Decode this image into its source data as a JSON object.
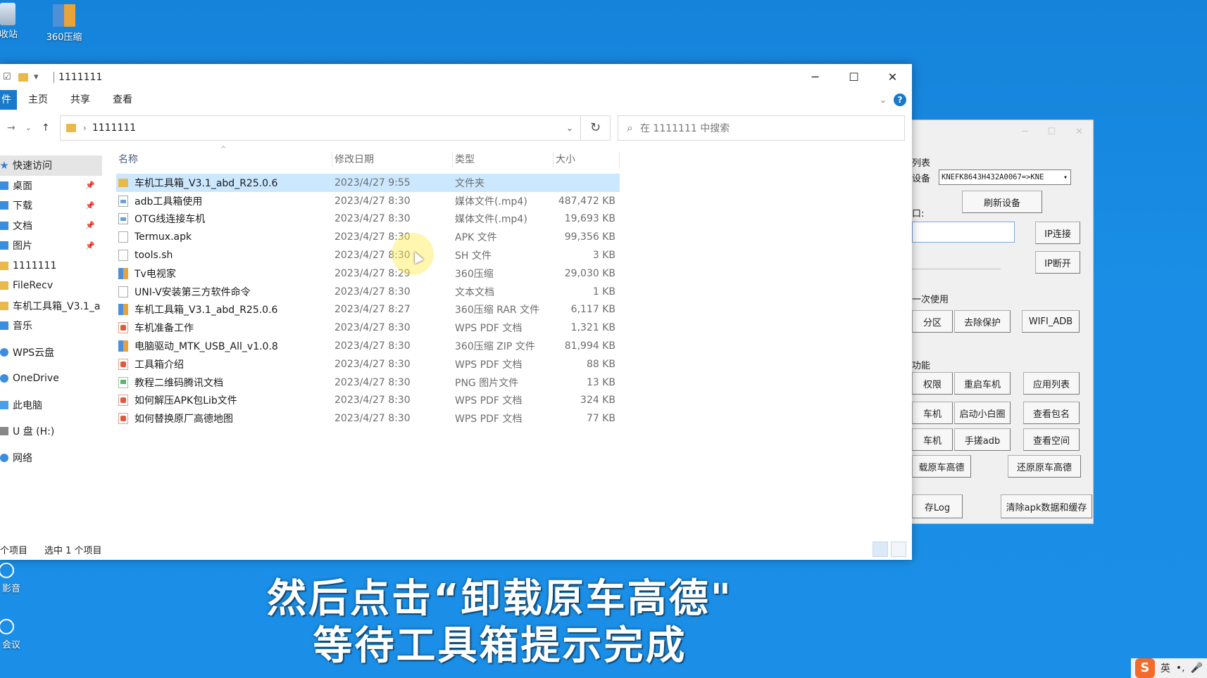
{
  "desktop": {
    "icons": [
      {
        "label": "收站"
      },
      {
        "label": "360压缩"
      },
      {
        "label": "影音"
      },
      {
        "label": "会议"
      }
    ]
  },
  "explorer": {
    "title": "1111111",
    "quick_access_chevron": "▾",
    "ribbon": {
      "file": "件",
      "tabs": [
        "主页",
        "共享",
        "查看"
      ],
      "help": "?"
    },
    "address": {
      "path": "1111111"
    },
    "search": {
      "placeholder": "在 1111111 中搜索"
    },
    "nav_pane": [
      {
        "label": "快速访问",
        "icon": "star-icon"
      },
      {
        "label": "桌面",
        "icon": "desktop-icon",
        "pinned": true
      },
      {
        "label": "下载",
        "icon": "download-icon",
        "pinned": true
      },
      {
        "label": "文档",
        "icon": "document-icon",
        "pinned": true
      },
      {
        "label": "图片",
        "icon": "pictures-icon",
        "pinned": true
      },
      {
        "label": "1111111",
        "icon": "folder-icon"
      },
      {
        "label": "FileRecv",
        "icon": "folder-icon"
      },
      {
        "label": "车机工具箱_V3.1_a",
        "icon": "folder-icon"
      },
      {
        "label": "音乐",
        "icon": "music-icon"
      },
      {
        "label": "WPS云盘",
        "icon": "cloud-icon"
      },
      {
        "label": "OneDrive",
        "icon": "cloud-icon"
      },
      {
        "label": "此电脑",
        "icon": "pc-icon"
      },
      {
        "label": "U 盘 (H:)",
        "icon": "drive-icon"
      },
      {
        "label": "网络",
        "icon": "network-icon"
      }
    ],
    "columns": [
      "名称",
      "修改日期",
      "类型",
      "大小"
    ],
    "files": [
      {
        "name": "车机工具箱_V3.1_abd_R25.0.6",
        "date": "2023/4/27 9:55",
        "type": "文件夹",
        "size": "",
        "icon": "folder",
        "selected": true
      },
      {
        "name": "adb工具箱使用",
        "date": "2023/4/27 8:30",
        "type": "媒体文件(.mp4)",
        "size": "487,472 KB",
        "icon": "video"
      },
      {
        "name": "OTG线连接车机",
        "date": "2023/4/27 8:30",
        "type": "媒体文件(.mp4)",
        "size": "19,693 KB",
        "icon": "video"
      },
      {
        "name": "Termux.apk",
        "date": "2023/4/27 8:30",
        "type": "APK 文件",
        "size": "99,356 KB",
        "icon": "doc"
      },
      {
        "name": "tools.sh",
        "date": "2023/4/27 8:30",
        "type": "SH 文件",
        "size": "3 KB",
        "icon": "doc"
      },
      {
        "name": "Tv电视家",
        "date": "2023/4/27 8:29",
        "type": "360压缩",
        "size": "29,030 KB",
        "icon": "zip"
      },
      {
        "name": "UNI-V安装第三方软件命令",
        "date": "2023/4/27 8:30",
        "type": "文本文档",
        "size": "1 KB",
        "icon": "doc"
      },
      {
        "name": "车机工具箱_V3.1_abd_R25.0.6",
        "date": "2023/4/27 8:27",
        "type": "360压缩 RAR 文件",
        "size": "6,117 KB",
        "icon": "zip"
      },
      {
        "name": "车机准备工作",
        "date": "2023/4/27 8:30",
        "type": "WPS PDF 文档",
        "size": "1,321 KB",
        "icon": "pdf"
      },
      {
        "name": "电脑驱动_MTK_USB_All_v1.0.8",
        "date": "2023/4/27 8:30",
        "type": "360压缩 ZIP 文件",
        "size": "81,994 KB",
        "icon": "zip"
      },
      {
        "name": "工具箱介绍",
        "date": "2023/4/27 8:30",
        "type": "WPS PDF 文档",
        "size": "88 KB",
        "icon": "pdf"
      },
      {
        "name": "教程二维码腾讯文档",
        "date": "2023/4/27 8:30",
        "type": "PNG 图片文件",
        "size": "13 KB",
        "icon": "png"
      },
      {
        "name": "如何解压APK包Lib文件",
        "date": "2023/4/27 8:30",
        "type": "WPS PDF 文档",
        "size": "324 KB",
        "icon": "pdf"
      },
      {
        "name": "如何替换原厂高德地图",
        "date": "2023/4/27 8:30",
        "type": "WPS PDF 文档",
        "size": "77 KB",
        "icon": "pdf"
      }
    ],
    "status": {
      "count": "个项目",
      "selected": "选中 1 个项目"
    }
  },
  "toolbox": {
    "device_list_label": "列表",
    "device_label": "设备",
    "device_value": "KNEFK8643H432A0067=>KNE",
    "refresh_button": "刷新设备",
    "port_label": "口:",
    "ip_connect": "IP连接",
    "ip_disconnect": "IP断开",
    "first_use_label": "一次使用",
    "partition_button": "分区",
    "remove_protect_button": "去除保护",
    "wifi_adb_button": "WIFI_ADB",
    "functions_label": "功能",
    "perm_button": "权限",
    "reboot_button": "重启车机",
    "app_list_button": "应用列表",
    "car_button_1": "车机",
    "start_dot_button": "启动小白圈",
    "view_pkg_button": "查看包名",
    "car_button_2": "车机",
    "hand_adb_button": "手搓adb",
    "view_space_button": "查看空间",
    "uninstall_amap_button": "载原车高德",
    "restore_amap_button": "还原原车高德",
    "save_log_button": "存Log",
    "clear_data_button": "清除apk数据和缓存"
  },
  "subtitles": {
    "line1": "然后点击“卸载原车高德\"",
    "line2": "等待工具箱提示完成"
  },
  "tray": {
    "ime_logo": "S",
    "ime_lang": "英",
    "punct": "•,",
    "mic": "🎤"
  }
}
